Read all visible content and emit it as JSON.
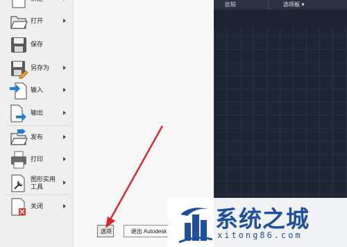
{
  "menu": {
    "items": [
      {
        "label": "新建",
        "icon": "new-file-icon",
        "has_submenu": true
      },
      {
        "label": "打开",
        "icon": "open-folder-icon",
        "has_submenu": true
      },
      {
        "label": "保存",
        "icon": "save-disk-icon",
        "has_submenu": false
      },
      {
        "label": "另存为",
        "icon": "save-as-icon",
        "has_submenu": true
      },
      {
        "label": "输入",
        "icon": "import-icon",
        "has_submenu": true
      },
      {
        "label": "输出",
        "icon": "export-icon",
        "has_submenu": true
      },
      {
        "label": "发布",
        "icon": "publish-icon",
        "has_submenu": true
      },
      {
        "label": "打印",
        "icon": "printer-icon",
        "has_submenu": true
      },
      {
        "label": "图形实用工具",
        "label_line1": "图形实用",
        "label_line2": "工具",
        "icon": "drawing-utilities-icon",
        "has_submenu": true
      },
      {
        "label": "关闭",
        "icon": "close-file-icon",
        "has_submenu": true
      }
    ],
    "options_button": "选项",
    "exit_button": "退出 Autodesk A"
  },
  "toolbar": {
    "compare_label": "比较",
    "palettes_label": "选项板 ▾"
  },
  "watermark": {
    "title": "系统之城",
    "url": "xitong86.com"
  },
  "colors": {
    "canvas_bg": "#1f2633",
    "menu_bg": "#f6f6f6",
    "annotation_arrow": "#e0262c",
    "watermark_blue": "#1f4fa0"
  }
}
